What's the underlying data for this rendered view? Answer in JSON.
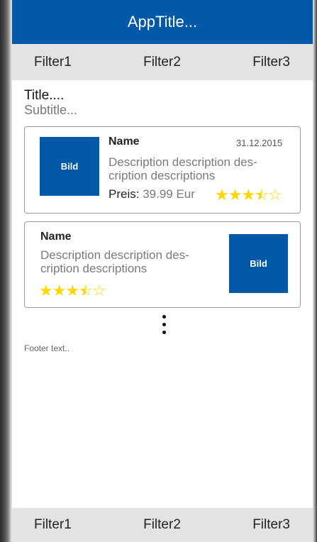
{
  "app": {
    "title": "AppTitle..."
  },
  "filters_top": [
    "Filter1",
    "Filter2",
    "Filter3"
  ],
  "header": {
    "title": "Title....",
    "subtitle": "Subtitle..."
  },
  "cards": [
    {
      "image_label": "Bild",
      "name": "Name",
      "date": "31.12.2015",
      "description": "Description description des-cription descriptions",
      "price_label": "Preis:",
      "price_value": "39.99 Eur",
      "rating": 3.5,
      "rating_max": 5
    },
    {
      "image_label": "Bild",
      "name": "Name",
      "description": "Description description des-cription descriptions",
      "rating": 3.5,
      "rating_max": 5
    }
  ],
  "footer": {
    "text": "Footer text.."
  },
  "filters_bottom": [
    "Filter1",
    "Filter2",
    "Filter3"
  ],
  "colors": {
    "primary": "#0059a8",
    "bar_bg": "#e3e3e3",
    "star": "#ffd700"
  },
  "icons": {
    "more": "more-vertical-icon",
    "star_full": "star-icon",
    "star_half": "star-half-icon",
    "star_empty": "star-outline-icon"
  }
}
